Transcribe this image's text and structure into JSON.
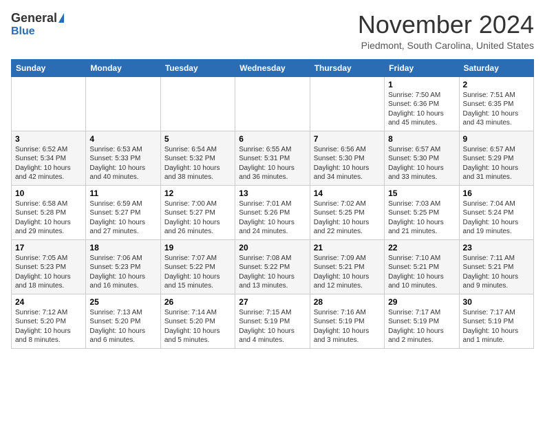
{
  "header": {
    "logo_general": "General",
    "logo_blue": "Blue",
    "month_title": "November 2024",
    "location": "Piedmont, South Carolina, United States"
  },
  "calendar": {
    "days_of_week": [
      "Sunday",
      "Monday",
      "Tuesday",
      "Wednesday",
      "Thursday",
      "Friday",
      "Saturday"
    ],
    "weeks": [
      [
        {
          "day": "",
          "info": ""
        },
        {
          "day": "",
          "info": ""
        },
        {
          "day": "",
          "info": ""
        },
        {
          "day": "",
          "info": ""
        },
        {
          "day": "",
          "info": ""
        },
        {
          "day": "1",
          "info": "Sunrise: 7:50 AM\nSunset: 6:36 PM\nDaylight: 10 hours\nand 45 minutes."
        },
        {
          "day": "2",
          "info": "Sunrise: 7:51 AM\nSunset: 6:35 PM\nDaylight: 10 hours\nand 43 minutes."
        }
      ],
      [
        {
          "day": "3",
          "info": "Sunrise: 6:52 AM\nSunset: 5:34 PM\nDaylight: 10 hours\nand 42 minutes."
        },
        {
          "day": "4",
          "info": "Sunrise: 6:53 AM\nSunset: 5:33 PM\nDaylight: 10 hours\nand 40 minutes."
        },
        {
          "day": "5",
          "info": "Sunrise: 6:54 AM\nSunset: 5:32 PM\nDaylight: 10 hours\nand 38 minutes."
        },
        {
          "day": "6",
          "info": "Sunrise: 6:55 AM\nSunset: 5:31 PM\nDaylight: 10 hours\nand 36 minutes."
        },
        {
          "day": "7",
          "info": "Sunrise: 6:56 AM\nSunset: 5:30 PM\nDaylight: 10 hours\nand 34 minutes."
        },
        {
          "day": "8",
          "info": "Sunrise: 6:57 AM\nSunset: 5:30 PM\nDaylight: 10 hours\nand 33 minutes."
        },
        {
          "day": "9",
          "info": "Sunrise: 6:57 AM\nSunset: 5:29 PM\nDaylight: 10 hours\nand 31 minutes."
        }
      ],
      [
        {
          "day": "10",
          "info": "Sunrise: 6:58 AM\nSunset: 5:28 PM\nDaylight: 10 hours\nand 29 minutes."
        },
        {
          "day": "11",
          "info": "Sunrise: 6:59 AM\nSunset: 5:27 PM\nDaylight: 10 hours\nand 27 minutes."
        },
        {
          "day": "12",
          "info": "Sunrise: 7:00 AM\nSunset: 5:27 PM\nDaylight: 10 hours\nand 26 minutes."
        },
        {
          "day": "13",
          "info": "Sunrise: 7:01 AM\nSunset: 5:26 PM\nDaylight: 10 hours\nand 24 minutes."
        },
        {
          "day": "14",
          "info": "Sunrise: 7:02 AM\nSunset: 5:25 PM\nDaylight: 10 hours\nand 22 minutes."
        },
        {
          "day": "15",
          "info": "Sunrise: 7:03 AM\nSunset: 5:25 PM\nDaylight: 10 hours\nand 21 minutes."
        },
        {
          "day": "16",
          "info": "Sunrise: 7:04 AM\nSunset: 5:24 PM\nDaylight: 10 hours\nand 19 minutes."
        }
      ],
      [
        {
          "day": "17",
          "info": "Sunrise: 7:05 AM\nSunset: 5:23 PM\nDaylight: 10 hours\nand 18 minutes."
        },
        {
          "day": "18",
          "info": "Sunrise: 7:06 AM\nSunset: 5:23 PM\nDaylight: 10 hours\nand 16 minutes."
        },
        {
          "day": "19",
          "info": "Sunrise: 7:07 AM\nSunset: 5:22 PM\nDaylight: 10 hours\nand 15 minutes."
        },
        {
          "day": "20",
          "info": "Sunrise: 7:08 AM\nSunset: 5:22 PM\nDaylight: 10 hours\nand 13 minutes."
        },
        {
          "day": "21",
          "info": "Sunrise: 7:09 AM\nSunset: 5:21 PM\nDaylight: 10 hours\nand 12 minutes."
        },
        {
          "day": "22",
          "info": "Sunrise: 7:10 AM\nSunset: 5:21 PM\nDaylight: 10 hours\nand 10 minutes."
        },
        {
          "day": "23",
          "info": "Sunrise: 7:11 AM\nSunset: 5:21 PM\nDaylight: 10 hours\nand 9 minutes."
        }
      ],
      [
        {
          "day": "24",
          "info": "Sunrise: 7:12 AM\nSunset: 5:20 PM\nDaylight: 10 hours\nand 8 minutes."
        },
        {
          "day": "25",
          "info": "Sunrise: 7:13 AM\nSunset: 5:20 PM\nDaylight: 10 hours\nand 6 minutes."
        },
        {
          "day": "26",
          "info": "Sunrise: 7:14 AM\nSunset: 5:20 PM\nDaylight: 10 hours\nand 5 minutes."
        },
        {
          "day": "27",
          "info": "Sunrise: 7:15 AM\nSunset: 5:19 PM\nDaylight: 10 hours\nand 4 minutes."
        },
        {
          "day": "28",
          "info": "Sunrise: 7:16 AM\nSunset: 5:19 PM\nDaylight: 10 hours\nand 3 minutes."
        },
        {
          "day": "29",
          "info": "Sunrise: 7:17 AM\nSunset: 5:19 PM\nDaylight: 10 hours\nand 2 minutes."
        },
        {
          "day": "30",
          "info": "Sunrise: 7:17 AM\nSunset: 5:19 PM\nDaylight: 10 hours\nand 1 minute."
        }
      ]
    ]
  }
}
